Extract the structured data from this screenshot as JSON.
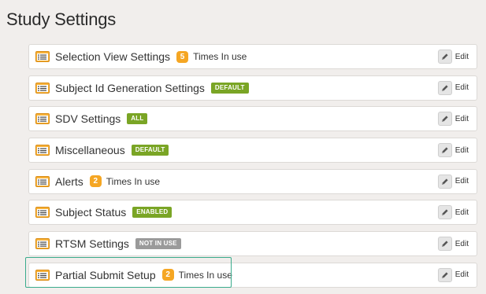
{
  "page": {
    "title": "Study Settings"
  },
  "settings": [
    {
      "label": "Selection View Settings",
      "count": "5",
      "times": "Times In use",
      "edit": "Edit"
    },
    {
      "label": "Subject Id Generation Settings",
      "badge": "DEFAULT",
      "badge_color": "#7aa525",
      "edit": "Edit"
    },
    {
      "label": "SDV Settings",
      "badge": "ALL",
      "badge_color": "#7aa525",
      "edit": "Edit"
    },
    {
      "label": "Miscellaneous",
      "badge": "DEFAULT",
      "badge_color": "#7aa525",
      "edit": "Edit"
    },
    {
      "label": "Alerts",
      "count": "2",
      "times": "Times In use",
      "edit": "Edit"
    },
    {
      "label": "Subject Status",
      "badge": "ENABLED",
      "badge_color": "#7aa525",
      "edit": "Edit"
    },
    {
      "label": "RTSM Settings",
      "badge": "NOT IN USE",
      "badge_color": "#9a9a9a",
      "edit": "Edit"
    },
    {
      "label": "Partial Submit Setup",
      "count": "2",
      "times": "Times In use",
      "edit": "Edit"
    }
  ],
  "icons": {
    "row": "settings-list-icon",
    "edit": "pencil-icon"
  },
  "colors": {
    "accent_orange": "#f5a623",
    "highlight": "#3aab8c"
  }
}
